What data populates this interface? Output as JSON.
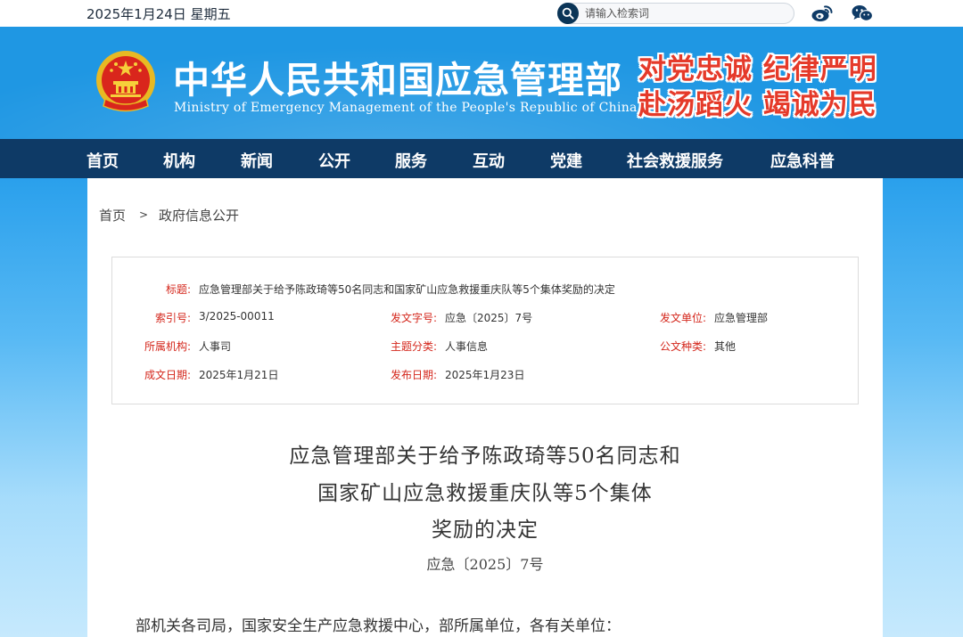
{
  "topbar": {
    "date": "2025年1月24日 星期五",
    "search_placeholder": "请输入检索词",
    "social_icons": [
      "weibo-icon",
      "wechat-icon"
    ]
  },
  "header": {
    "site_title": "中华人民共和国应急管理部",
    "site_subtitle": "Ministry of Emergency Management of the People's Republic of China",
    "slogan_line1": "对党忠诚 纪律严明",
    "slogan_line2": "赴汤蹈火 竭诚为民",
    "colors": {
      "banner": "#1f97e3",
      "nav": "#0e3a66",
      "slogan": "#e53a2a",
      "label_red": "#d4261b"
    }
  },
  "nav": {
    "items": [
      "首页",
      "机构",
      "新闻",
      "公开",
      "服务",
      "互动",
      "党建",
      "社会救援服务",
      "应急科普"
    ]
  },
  "breadcrumb": {
    "home": "首页",
    "separator": ">",
    "current": "政府信息公开"
  },
  "info": {
    "title_label": "标题:",
    "title_value": "应急管理部关于给予陈政琦等50名同志和国家矿山应急救援重庆队等5个集体奖励的决定",
    "index_label": "索引号:",
    "index_value": "3/2025-00011",
    "docno_label": "发文字号:",
    "docno_value": "应急〔2025〕7号",
    "issuer_label": "发文单位:",
    "issuer_value": "应急管理部",
    "org_label": "所属机构:",
    "org_value": "人事司",
    "category_label": "主题分类:",
    "category_value": "人事信息",
    "type_label": "公文种类:",
    "type_value": "其他",
    "created_label": "成文日期:",
    "created_value": "2025年1月21日",
    "published_label": "发布日期:",
    "published_value": "2025年1月23日"
  },
  "document": {
    "title_line1": "应急管理部关于给予陈政琦等50名同志和",
    "title_line2": "国家矿山应急救援重庆队等5个集体",
    "title_line3": "奖励的决定",
    "number": "应急〔2025〕7号",
    "first_paragraph": "部机关各司局，国家安全生产应急救援中心，部所属单位，各有关单位："
  }
}
